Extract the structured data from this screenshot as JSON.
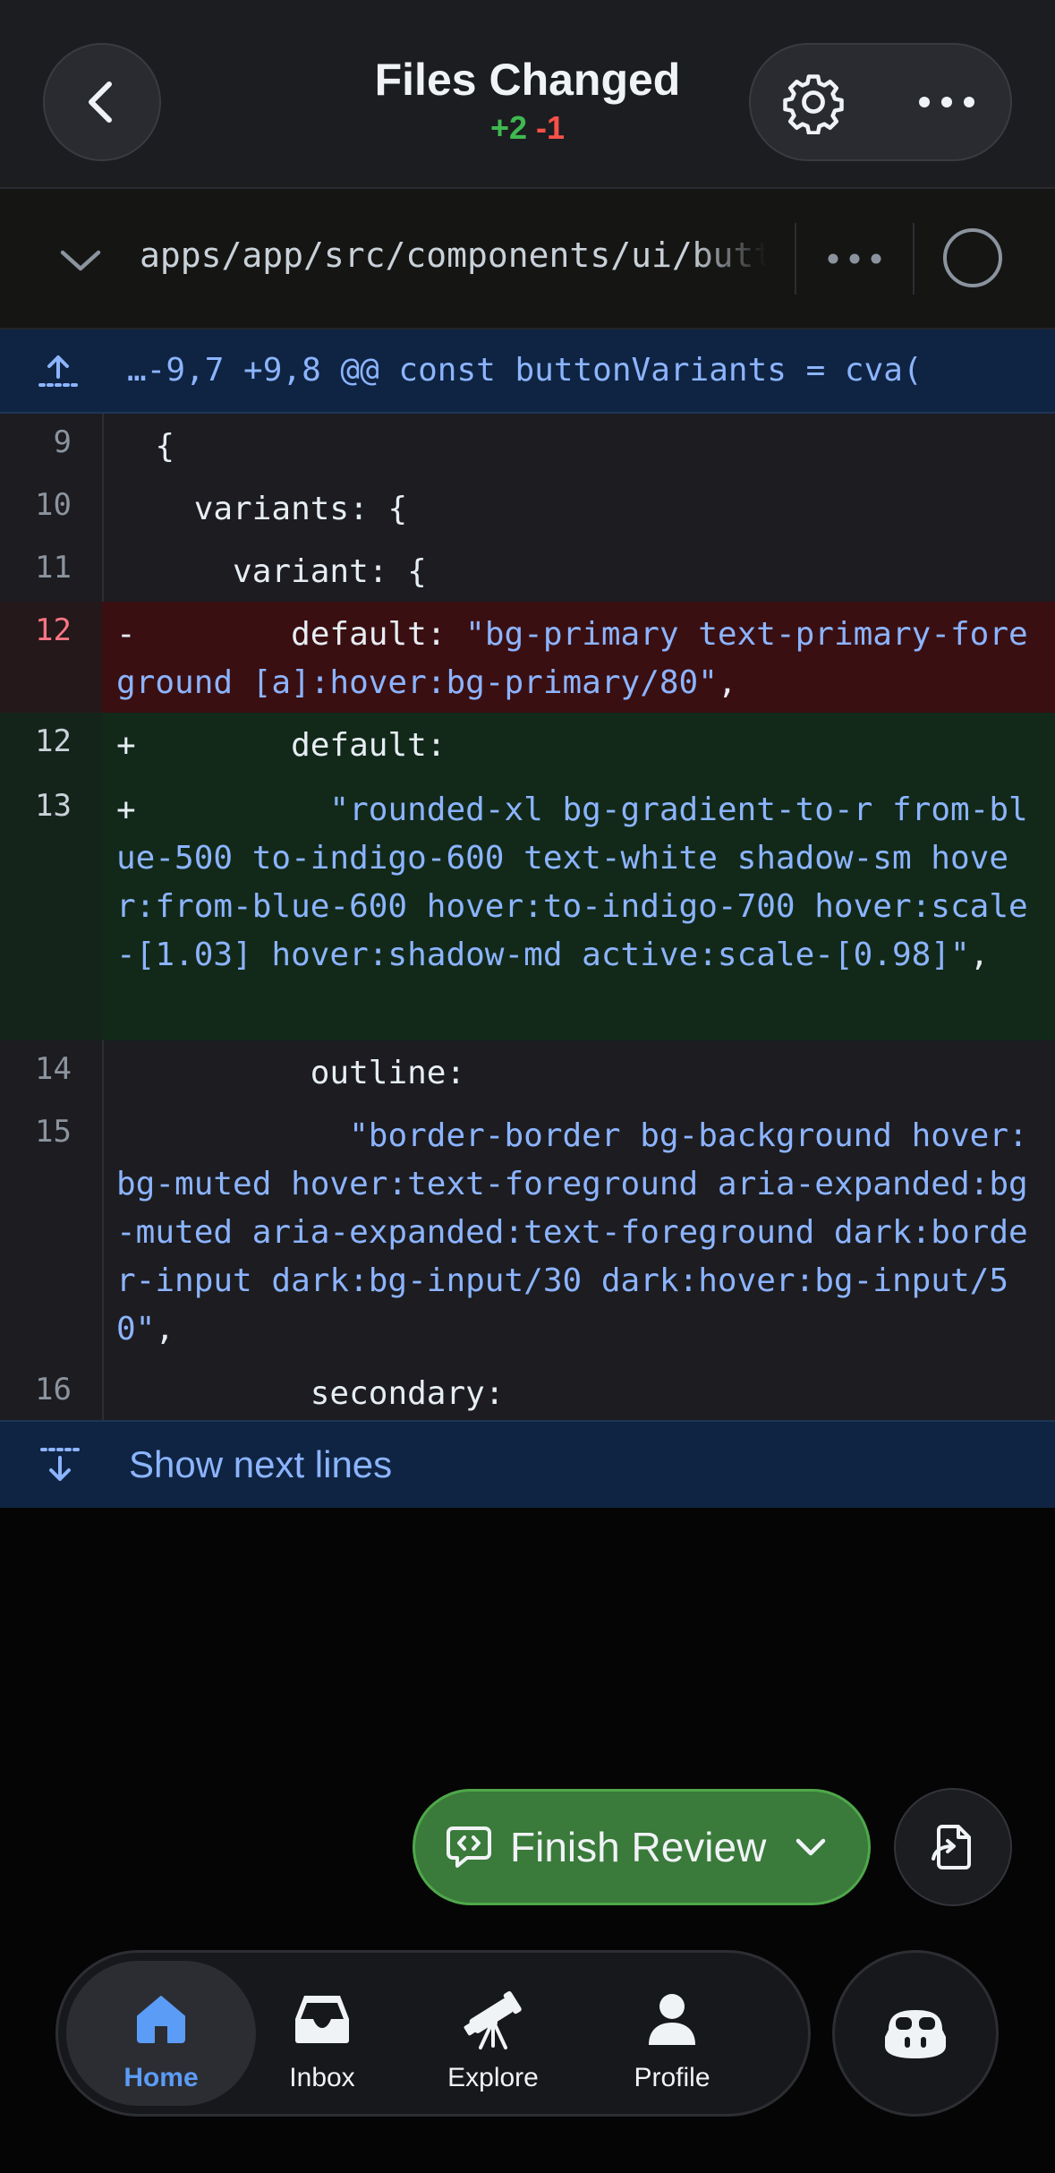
{
  "header": {
    "title": "Files Changed",
    "additions": "+2",
    "deletions": "-1"
  },
  "file": {
    "path": "apps/app/src/components/ui/button.tsx"
  },
  "hunk": {
    "header": "…-9,7 +9,8 @@ const buttonVariants = cva("
  },
  "diff": {
    "lines": [
      {
        "num": "9",
        "prefix": "",
        "code": "  {"
      },
      {
        "num": "10",
        "prefix": "",
        "code": "    variants: {"
      },
      {
        "num": "11",
        "prefix": "",
        "code": "      variant: {"
      },
      {
        "num": "12",
        "prefix": "-",
        "key": "        default: ",
        "str": "\"bg-primary text-primary-foreground [a]:hover:bg-primary/80\"",
        "tail": ","
      },
      {
        "num": "12",
        "prefix": "+",
        "key": "        default:"
      },
      {
        "num": "13",
        "prefix": "+",
        "str": "          \"rounded-xl bg-gradient-to-r from-blue-500 to-indigo-600 text-white shadow-sm hover:from-blue-600 hover:to-indigo-700 hover:scale-[1.03] hover:shadow-md active:scale-[0.98]\"",
        "tail": ","
      },
      {
        "num": "14",
        "prefix": "",
        "code": "          outline:"
      },
      {
        "num": "15",
        "prefix": "",
        "str": "            \"border-border bg-background hover:bg-muted hover:text-foreground aria-expanded:bg-muted aria-expanded:text-foreground dark:border-input dark:bg-input/30 dark:hover:bg-input/50\"",
        "tail": ","
      },
      {
        "num": "16",
        "prefix": "",
        "code": "          secondary:"
      }
    ]
  },
  "show_next": {
    "label": "Show next lines"
  },
  "review": {
    "finish_label": "Finish Review"
  },
  "tabs": [
    {
      "label": "Home",
      "icon": "house-icon",
      "active": true
    },
    {
      "label": "Inbox",
      "icon": "inbox-tray-icon",
      "active": false
    },
    {
      "label": "Explore",
      "icon": "telescope-icon",
      "active": false
    },
    {
      "label": "Profile",
      "icon": "person-icon",
      "active": false
    }
  ],
  "colors": {
    "accent_blue": "#5b9cf6",
    "addition_green": "#3fb950",
    "deletion_red": "#f85149",
    "finish_review_bg": "#3a7a3a"
  }
}
